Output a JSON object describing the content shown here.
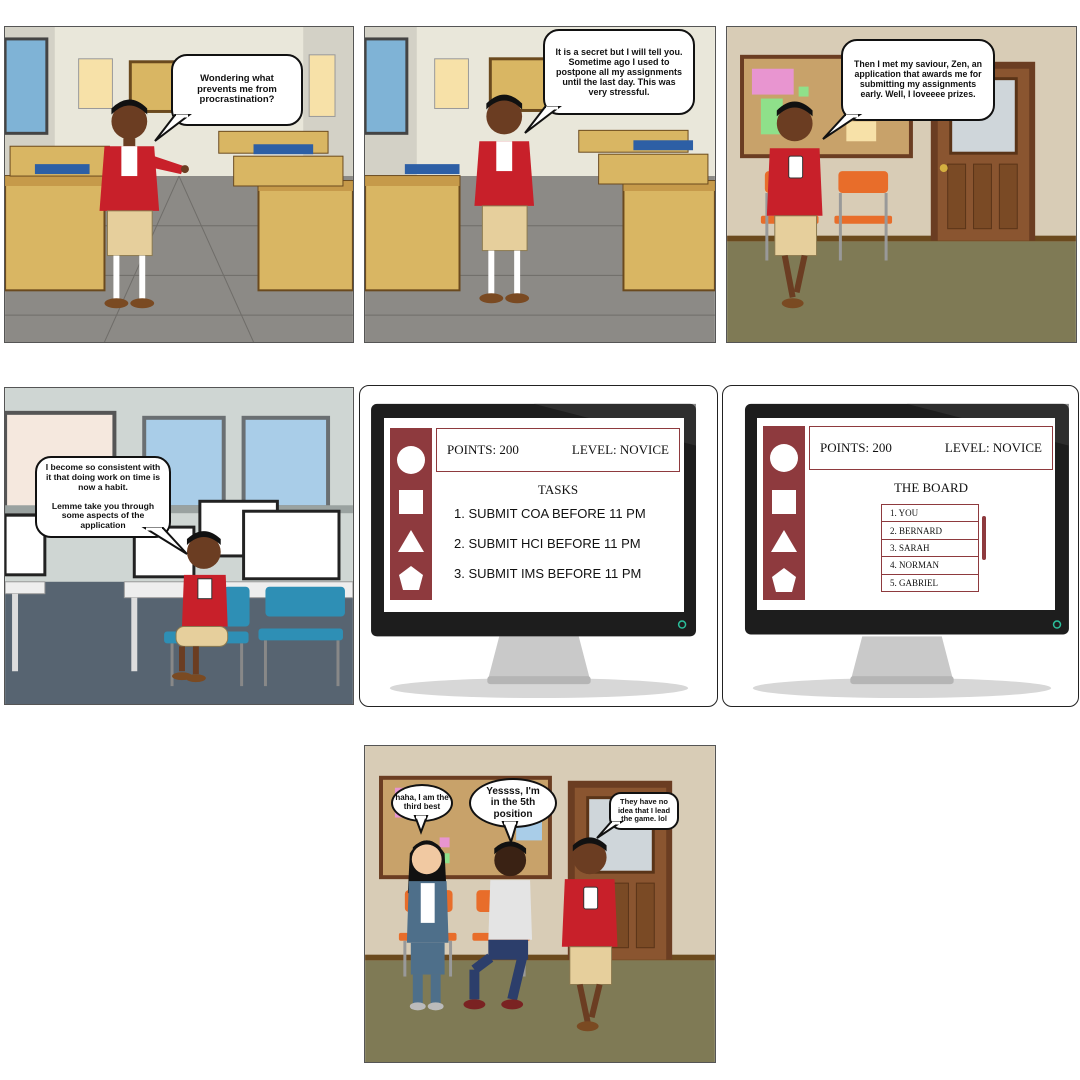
{
  "panels": {
    "p1": {
      "bubble": "Wondering what prevents me from procrastination?"
    },
    "p2": {
      "bubble": "It is a secret but I will tell you. Sometime ago I used to postpone all my assignments until the last day. This was very stressful."
    },
    "p3": {
      "bubble": "Then I met my saviour, Zen, an application that awards me for submitting my assignments early. Well, I loveeee prizes."
    },
    "p4": {
      "bubble": "I become so consistent with it that doing work on time is now a habit.\n\nLemme take you through some aspects of the application"
    },
    "p5": {
      "points_label": "POINTS:  200",
      "level_label": "LEVEL:  NOVICE",
      "title": "TASKS",
      "tasks": [
        "1. SUBMIT COA BEFORE 11 PM",
        "2. SUBMIT HCI BEFORE 11 PM",
        "3. SUBMIT IMS BEFORE 11 PM"
      ],
      "icons": [
        "circle-icon",
        "square-icon",
        "triangle-icon",
        "pentagon-icon"
      ]
    },
    "p6": {
      "points_label": "POINTS:  200",
      "level_label": "LEVEL:  NOVICE",
      "title": "THE BOARD",
      "board": [
        "1.  YOU",
        "2.  BERNARD",
        "3.  SARAH",
        "4.  NORMAN",
        "5.  GABRIEL"
      ],
      "icons": [
        "circle-icon",
        "square-icon",
        "triangle-icon",
        "pentagon-icon"
      ]
    },
    "p7": {
      "bubble_girl": "haha, I am the third best",
      "bubble_boy": "Yessss, I'm in the 5th position",
      "bubble_hero": "They have no idea that I lead the game. lol"
    }
  },
  "colors": {
    "accent": "#8e3a3e",
    "jacket": "#c8202a",
    "shorts": "#e6cf9c",
    "wall": "#e9e7da",
    "desk": "#d9b663",
    "floor": "#8c8a86"
  }
}
